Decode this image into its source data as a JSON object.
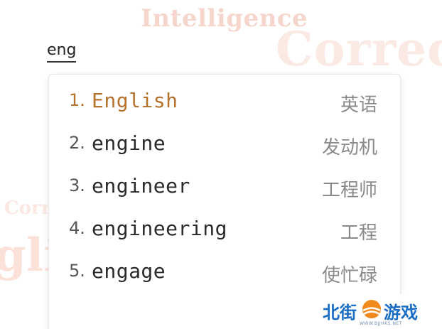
{
  "background": {
    "words": [
      "Intelligence",
      "Correcti",
      "Corr",
      "glis"
    ]
  },
  "query": {
    "value": "eng"
  },
  "suggestions": [
    {
      "num": "1.",
      "word": "English",
      "translation": "英语",
      "selected": true
    },
    {
      "num": "2.",
      "word": "engine",
      "translation": "发动机",
      "selected": false
    },
    {
      "num": "3.",
      "word": "engineer",
      "translation": "工程师",
      "selected": false
    },
    {
      "num": "4.",
      "word": "engineering",
      "translation": "工程",
      "selected": false
    },
    {
      "num": "5.",
      "word": "engage",
      "translation": "使忙碌",
      "selected": false
    }
  ],
  "watermark": {
    "text_left": "北街",
    "text_right": "游戏",
    "url": "WWW.BJJHKS.NET"
  },
  "colors": {
    "selected_text": "#b5722c",
    "normal_text": "#2a2a2a",
    "translation_text": "#8a8a8a",
    "logo_blue": "#1a6fc4",
    "logo_orange": "#f08a1c"
  }
}
